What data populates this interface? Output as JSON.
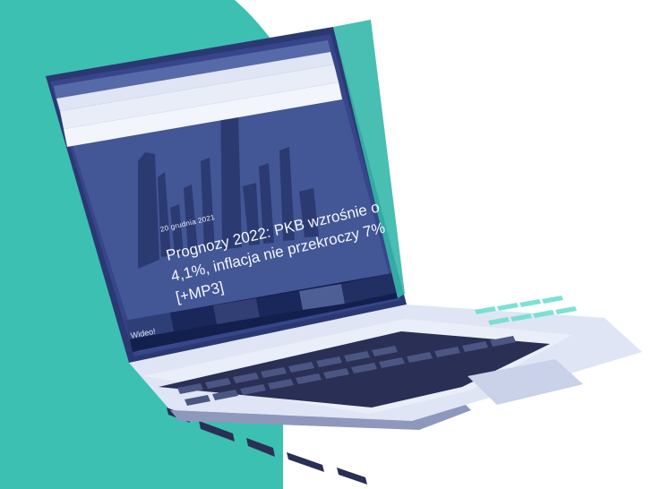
{
  "colors": {
    "teal": "#3cc0b2",
    "navy": "#1f2d66",
    "screen_blue": "#3e4f8d",
    "keyboard": "#272c53",
    "keyboard_highlight": "#6edfd0"
  },
  "screen": {
    "date": "20 grudnia 2021",
    "headline": "Prognozy 2022: PKB wzrośnie o 4,1%, inflacja nie przekroczy 7% [+MP3]",
    "section_label": "Wideo!"
  },
  "icons": [
    "laptop-icon",
    "city-skyline-icon"
  ]
}
